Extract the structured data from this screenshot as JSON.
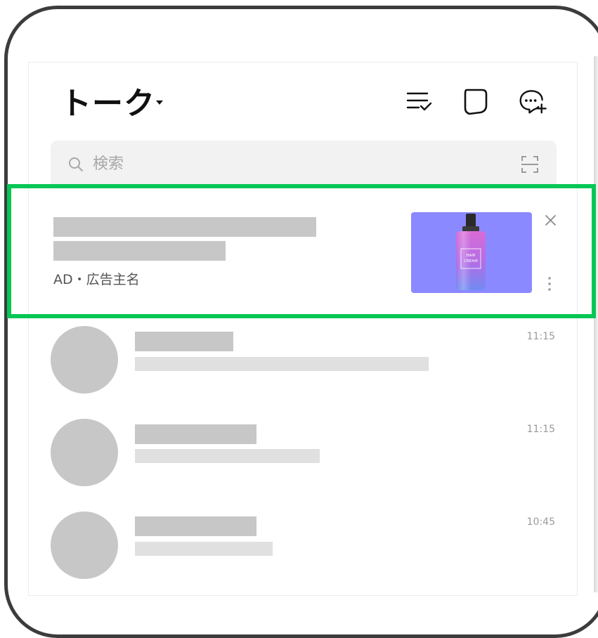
{
  "header": {
    "title": "トーク",
    "icons": [
      "sort-check-icon",
      "chat-bubble-icon",
      "new-chat-icon"
    ]
  },
  "search": {
    "placeholder": "検索",
    "icon": "search-icon",
    "scan_icon": "qr-scan-icon"
  },
  "ad": {
    "label": "AD・広告主名",
    "image_text_line1": "HAIR",
    "image_text_line2": "CREAM",
    "close_icon": "close-icon",
    "more_icon": "more-vertical-icon",
    "highlight_color": "#06c755",
    "image_background": "#8b89ff"
  },
  "chats": [
    {
      "time": "11:15"
    },
    {
      "time": "11:15"
    },
    {
      "time": "10:45"
    }
  ],
  "colors": {
    "frame": "#3c3c3c",
    "placeholder_gray": "#c7c7c7",
    "light_gray": "#e0e0e0",
    "accent_green": "#06c755"
  }
}
